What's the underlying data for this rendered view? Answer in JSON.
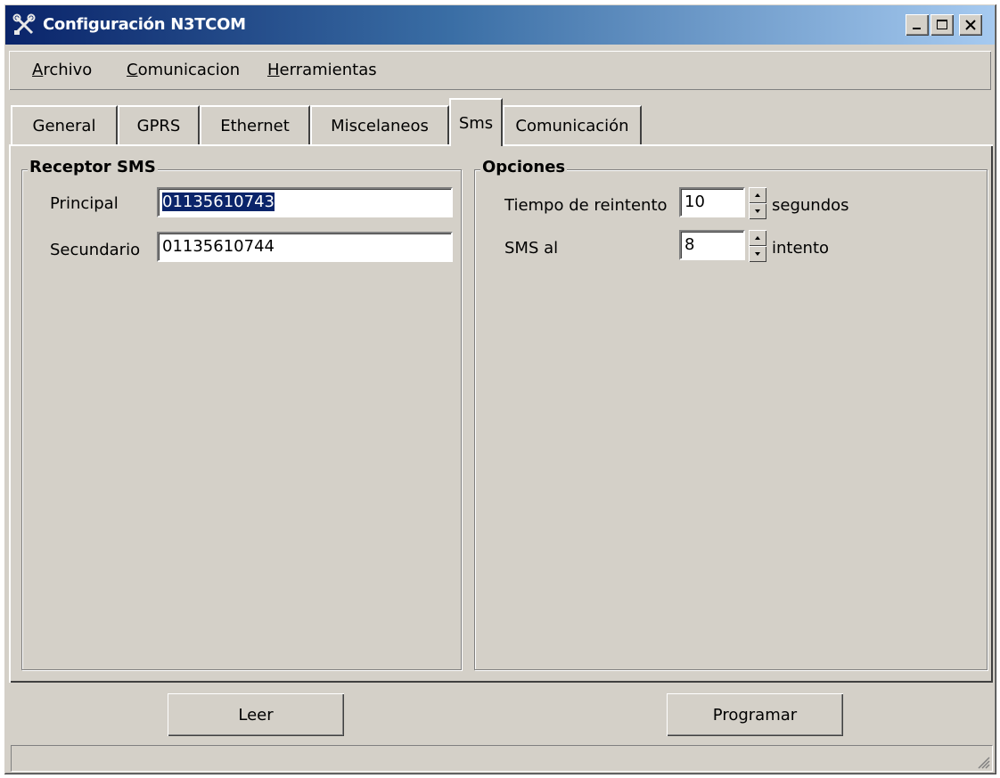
{
  "window": {
    "title": "Configuración N3TCOM",
    "icon": "tools-icon"
  },
  "menu": {
    "items": [
      {
        "accel": "A",
        "rest": "rchivo"
      },
      {
        "accel": "C",
        "rest": "omunicacion"
      },
      {
        "accel": "H",
        "rest": "erramientas"
      }
    ]
  },
  "tabs": [
    "General",
    "GPRS",
    "Ethernet",
    "Miscelaneos",
    "Sms",
    "Comunicación"
  ],
  "active_tab": "Sms",
  "receptor": {
    "title": "Receptor SMS",
    "principal_label": "Principal",
    "principal_value": "01135610743",
    "secundario_label": "Secundario",
    "secundario_value": "01135610744"
  },
  "opciones": {
    "title": "Opciones",
    "retry_label": "Tiempo de reintento",
    "retry_value": "10",
    "retry_unit": "segundos",
    "sms_label": "SMS al",
    "sms_value": "8",
    "sms_unit": "intento"
  },
  "buttons": {
    "read": "Leer",
    "program": "Programar"
  }
}
